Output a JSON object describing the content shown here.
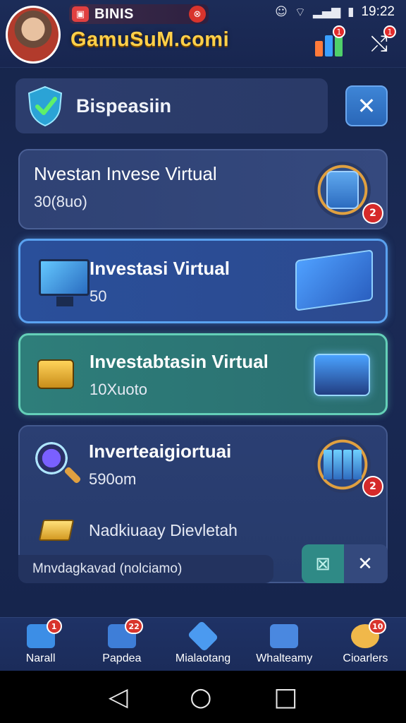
{
  "status_bar": {
    "time": "19:22",
    "icons": [
      "avatar-icon",
      "wifi-icon",
      "signal-icon",
      "signal-alt-icon",
      "battery-icon"
    ]
  },
  "header": {
    "app_label": "BINIS",
    "site_title": "GamuSuM.comi",
    "chart_badge": "1",
    "share_badge": "1"
  },
  "section": {
    "title": "Bispeasiin",
    "close_label": "✕"
  },
  "cards": [
    {
      "title": "Nvestan Invese Virtual",
      "value": "30(8uo)",
      "badge": "2"
    },
    {
      "title": "Investasi Virtual",
      "value": "50"
    },
    {
      "title": "Investabtasin Virtual",
      "value": "10Xuoto"
    },
    {
      "title": "Inverteaigiortuai",
      "value": "590om",
      "badge": "2",
      "extra": "Nadkiuaay Dievletah"
    }
  ],
  "bottom_strip": {
    "text": "Mnvdagkavad (nolciamo)",
    "check_label": "⊠",
    "close_label": "✕"
  },
  "bottom_nav": [
    {
      "label": "Narall",
      "badge": "1",
      "color": "#3c8ee6"
    },
    {
      "label": "Papdea",
      "badge": "22",
      "color": "#3e7ed8"
    },
    {
      "label": "Mialaotang",
      "badge": "",
      "color": "#4b9af0"
    },
    {
      "label": "Whalteamy",
      "badge": "",
      "color": "#4a88e0"
    },
    {
      "label": "Cioarlers",
      "badge": "10",
      "color": "#f0b84a"
    }
  ],
  "system_nav": {
    "back": "◁",
    "home": "○",
    "recents": "□"
  }
}
